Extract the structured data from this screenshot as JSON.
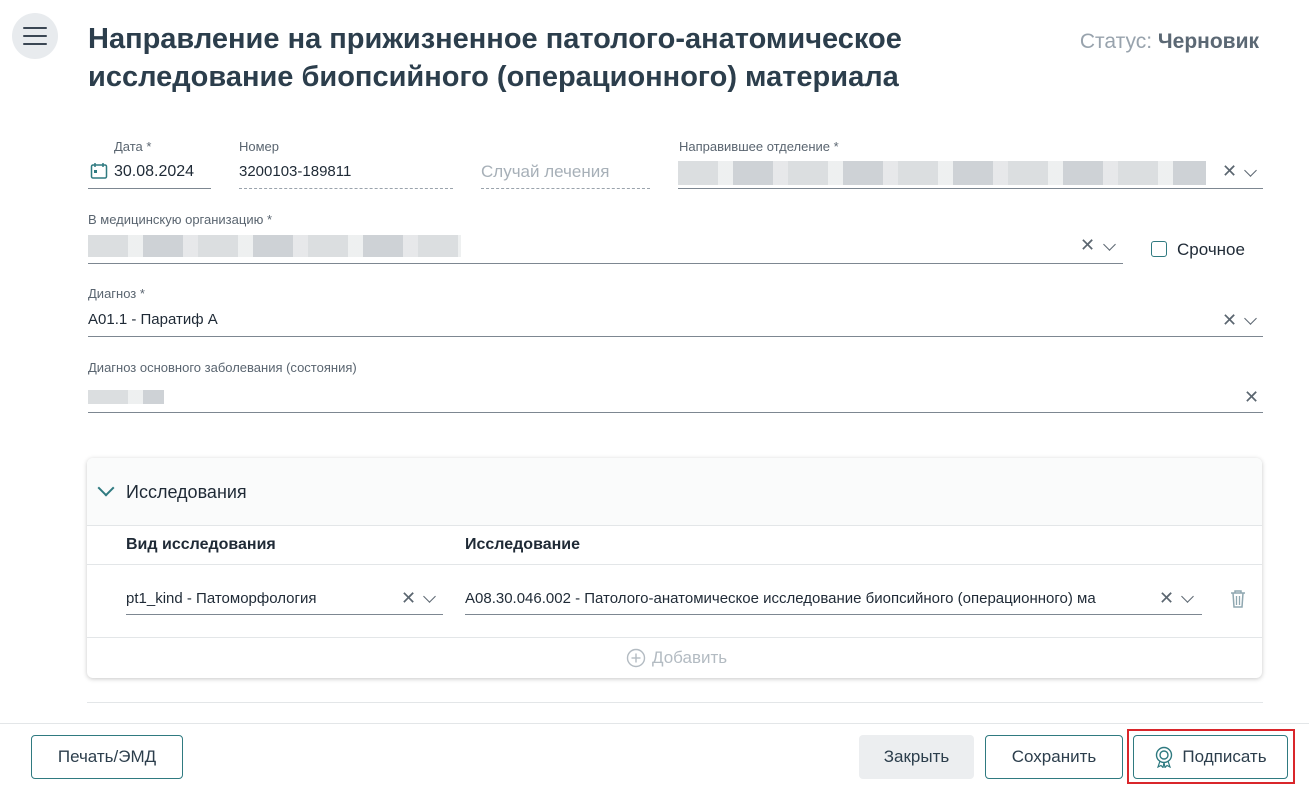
{
  "header": {
    "title_line1": "Направление на прижизненное патолого-анатомическое",
    "title_line2": "исследование биопсийного (операционного) материала",
    "status_label": "Статус:",
    "status_value": "Черновик"
  },
  "form": {
    "date": {
      "label": "Дата *",
      "value": "30.08.2024"
    },
    "number": {
      "label": "Номер",
      "value": "3200103-189811"
    },
    "case": {
      "placeholder": "Случай лечения"
    },
    "department": {
      "label": "Направившее отделение *"
    },
    "organization": {
      "label": "В медицинскую организацию *"
    },
    "urgent": {
      "label": "Срочное",
      "checked": false
    },
    "diagnosis": {
      "label": "Диагноз *",
      "value": "A01.1 - Паратиф А"
    },
    "main_diagnosis": {
      "label": "Диагноз основного заболевания (состояния)"
    }
  },
  "studies": {
    "section_title": "Исследования",
    "col_kind": "Вид исследования",
    "col_study": "Исследование",
    "rows": [
      {
        "kind": "pt1_kind - Патоморфология",
        "study": "A08.30.046.002 - Патолого-анатомическое исследование биопсийного (операционного) ма"
      }
    ],
    "add_label": "Добавить"
  },
  "footer": {
    "print_label": "Печать/ЭМД",
    "close_label": "Закрыть",
    "save_label": "Сохранить",
    "sign_label": "Подписать"
  },
  "colors": {
    "accent": "#2f7a80",
    "highlight": "#d9262b"
  }
}
